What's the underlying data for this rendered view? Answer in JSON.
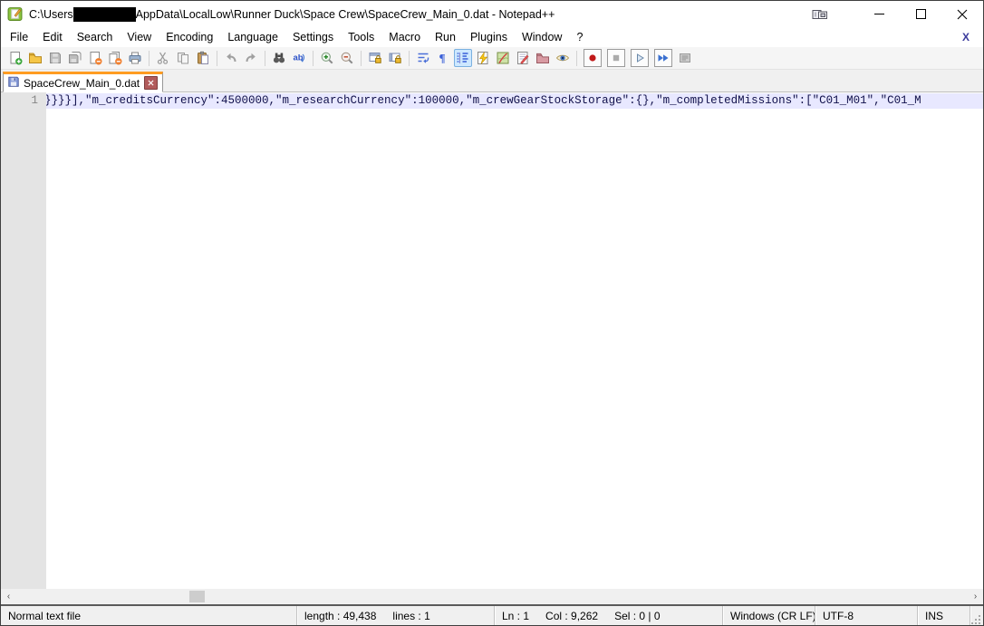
{
  "window": {
    "title_prefix": "C:\\Users",
    "title_redacted": "username-redacted",
    "title_suffix": "AppData\\LocalLow\\Runner Duck\\Space Crew\\SpaceCrew_Main_0.dat - Notepad++",
    "controls": {
      "minimize": "minimize",
      "maximize": "maximize",
      "close": "close"
    }
  },
  "menu": {
    "items": [
      "File",
      "Edit",
      "Search",
      "View",
      "Encoding",
      "Language",
      "Settings",
      "Tools",
      "Macro",
      "Run",
      "Plugins",
      "Window",
      "?"
    ],
    "close_x": "X"
  },
  "toolbar": {
    "groups": [
      [
        {
          "name": "new-file"
        },
        {
          "name": "open-folder"
        },
        {
          "name": "save",
          "state": "disabled"
        },
        {
          "name": "save-all",
          "state": "disabled"
        },
        {
          "name": "close-file"
        },
        {
          "name": "close-all-files"
        },
        {
          "name": "print"
        }
      ],
      [
        {
          "name": "cut",
          "state": "disabled"
        },
        {
          "name": "copy",
          "state": "disabled"
        },
        {
          "name": "paste"
        }
      ],
      [
        {
          "name": "undo",
          "state": "disabled"
        },
        {
          "name": "redo",
          "state": "disabled"
        }
      ],
      [
        {
          "name": "find"
        },
        {
          "name": "replace"
        }
      ],
      [
        {
          "name": "zoom-in"
        },
        {
          "name": "zoom-out"
        }
      ],
      [
        {
          "name": "sync-vertical-scroll"
        },
        {
          "name": "sync-horizontal-scroll"
        }
      ],
      [
        {
          "name": "word-wrap"
        },
        {
          "name": "show-all-characters"
        },
        {
          "name": "show-indent-guide",
          "state": "active"
        },
        {
          "name": "function-list"
        },
        {
          "name": "document-map"
        },
        {
          "name": "document-list"
        },
        {
          "name": "folder-as-workspace"
        },
        {
          "name": "monitoring"
        }
      ],
      [
        {
          "name": "macro-record",
          "boxed": true
        },
        {
          "name": "macro-stop",
          "state": "disabled",
          "boxed": true
        },
        {
          "name": "macro-play",
          "boxed": true
        },
        {
          "name": "macro-run-multiple",
          "boxed": true
        },
        {
          "name": "macro-save",
          "state": "disabled"
        }
      ]
    ]
  },
  "tabbar": {
    "tab": {
      "label": "SpaceCrew_Main_0.dat",
      "active": true,
      "icon": "saved-floppy-icon",
      "close": "x"
    }
  },
  "editor": {
    "line_number": "1",
    "line_text": "}}}}],\"m_creditsCurrency\":4500000,\"m_researchCurrency\":100000,\"m_crewGearStockStorage\":{},\"m_completedMissions\":[\"C01_M01\",\"C01_M",
    "current_line_highlight": "#E8E8FF"
  },
  "scrollbar": {
    "left_arrow": "‹",
    "right_arrow": "›"
  },
  "statusbar": {
    "doc_type": "Normal text file",
    "length_label": "length : 49,438",
    "lines_label": "lines : 1",
    "ln": "Ln : 1",
    "col": "Col : 9,262",
    "sel": "Sel : 0 | 0",
    "eol": "Windows (CR LF)",
    "encoding": "UTF-8",
    "mode": "INS"
  },
  "colors": {
    "tab_accent_orange": "#FF9C21",
    "current_line": "#E8E8FF",
    "gutter_bg": "#E4E4E4",
    "statusbar_bg": "#F0F0F0",
    "macro_record_red": "#C01818",
    "tab_close_red": "#B25B5B"
  }
}
